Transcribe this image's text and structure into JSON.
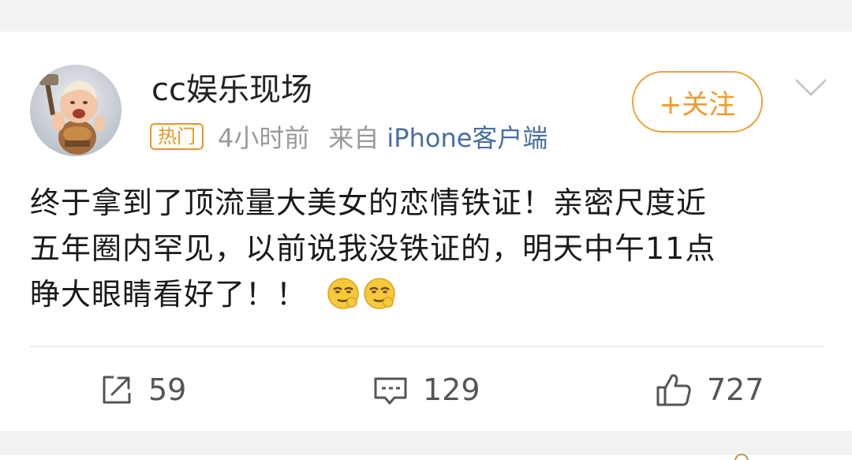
{
  "post": {
    "username": "cc娱乐现场",
    "badge": "热门",
    "time": "4小时前",
    "from_label": "来自",
    "source": "iPhone客户端",
    "follow_label": "+关注",
    "content_lines": [
      "终于拿到了顶流量大美女的恋情铁证！亲密尺度近",
      "五年圈内罕见，以前说我没铁证的，明天中午11点",
      "睁大眼睛看好了！！"
    ],
    "emoji": [
      "smirk-emoji",
      "smirk-emoji"
    ]
  },
  "actions": {
    "share_count": "59",
    "comment_count": "129",
    "like_count": "727"
  },
  "icons": {
    "share": "share-icon",
    "comment": "comment-icon",
    "like": "like-icon",
    "more": "chevron-down-icon"
  },
  "colors": {
    "accent": "#f09a2d",
    "link": "#486fa2",
    "muted": "#9a9a9a",
    "background": "#f2f2f2"
  }
}
